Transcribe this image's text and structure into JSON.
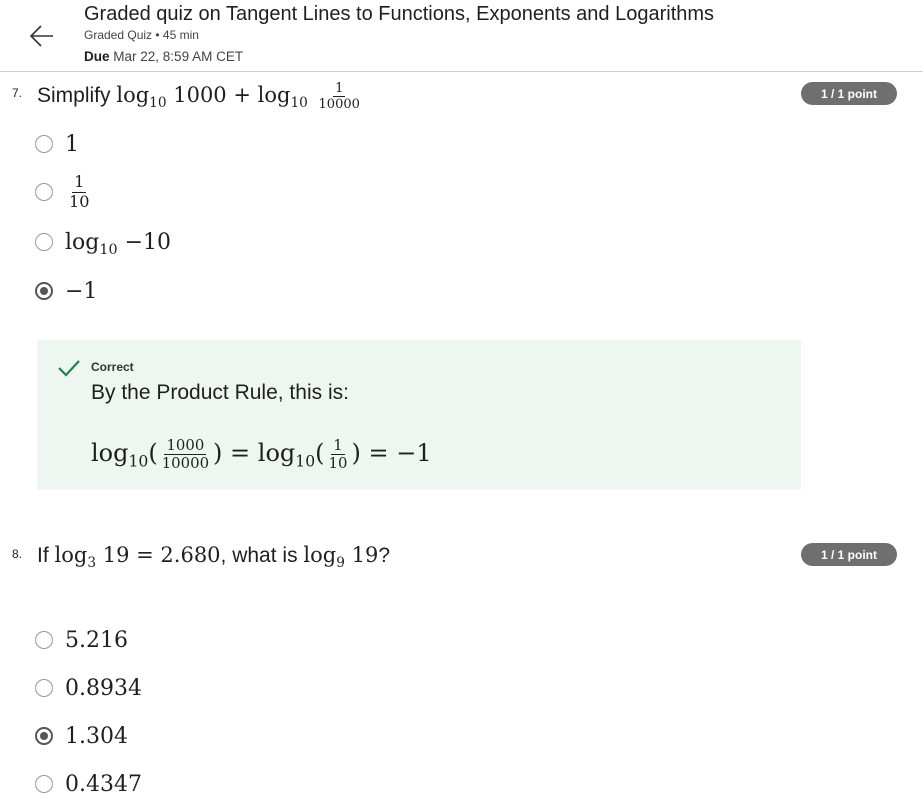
{
  "header": {
    "title": "Graded quiz on Tangent Lines to Functions, Exponents and Logarithms",
    "meta": "Graded Quiz • 45 min",
    "due_label": "Due",
    "due_value": "Mar 22, 8:59 AM CET"
  },
  "q7": {
    "number": "7.",
    "prompt": "Simplify",
    "math": {
      "log": "log",
      "base": "10",
      "term1": "1000",
      "plus": "+",
      "num": "1",
      "den": "10000"
    },
    "points": "1 / 1 point",
    "options": [
      {
        "text": "1",
        "selected": false
      },
      {
        "num": "1",
        "den": "10",
        "selected": false
      },
      {
        "log": "log",
        "base": "10",
        "arg": "−10",
        "selected": false
      },
      {
        "text": "−1",
        "selected": true
      }
    ],
    "feedback": {
      "status": "Correct",
      "text": "By the Product Rule, this is:",
      "math": {
        "log": "log",
        "base": "10",
        "num1": "1000",
        "den1": "10000",
        "num2": "1",
        "den2": "10",
        "eq": "=",
        "result": "−1"
      }
    }
  },
  "q8": {
    "number": "8.",
    "pre": "If",
    "log": "log",
    "base1": "3",
    "arg": "19",
    "eq": "=",
    "value": "2.680",
    "mid": ", what is",
    "base2": "9",
    "post": "?",
    "points": "1 / 1 point",
    "options": [
      {
        "text": "5.216",
        "selected": false
      },
      {
        "text": "0.8934",
        "selected": false
      },
      {
        "text": "1.304",
        "selected": true
      },
      {
        "text": "0.4347",
        "selected": false
      }
    ]
  },
  "colors": {
    "badge": "#6f6f6f",
    "feedback_bg": "#eef6f1",
    "check": "#1e8449",
    "divider": "#cfcfcf"
  }
}
